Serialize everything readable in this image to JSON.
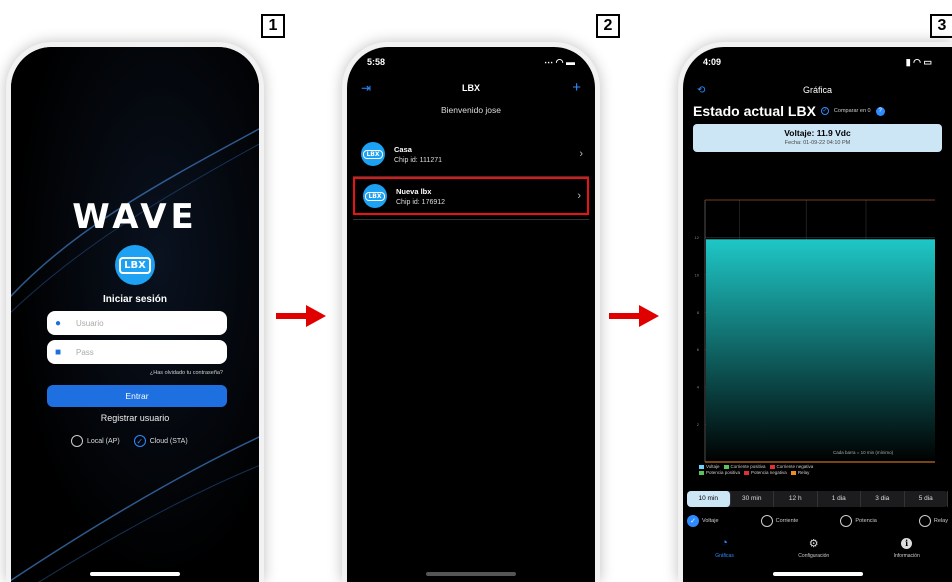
{
  "steps": [
    "1",
    "2",
    "3"
  ],
  "screen1": {
    "logo": "WAVE",
    "device_icon": "LBX",
    "title": "Iniciar sesión",
    "user_placeholder": "Usuario",
    "pass_placeholder": "Pass",
    "forgot": "¿Has olvidado tu contraseña?",
    "login_button": "Entrar",
    "register": "Registrar usuario",
    "mode_local": "Local (AP)",
    "mode_cloud": "Cloud (STA)",
    "mode_selected": "cloud"
  },
  "screen2": {
    "time": "5:58",
    "title": "LBX",
    "welcome": "Bienvenido jose",
    "devices": [
      {
        "name": "Casa",
        "chip": "Chip id: 111271",
        "selected": false
      },
      {
        "name": "Nueva lbx",
        "chip": "Chip id: 176912",
        "selected": true
      }
    ]
  },
  "screen3": {
    "time": "4:09",
    "nav_title": "Gráfica",
    "heading": "Estado actual LBX",
    "compare": "Comparar en 0",
    "voltage": "Voltaje: 11.9 Vdc",
    "date": "Fecha: 01-09-22 04:10 PM",
    "interval_note": "Cada barra = 10 min (mínimo)",
    "legend": [
      {
        "label": "Voltaje",
        "color": "#6ad2ff"
      },
      {
        "label": "Corriente positiva",
        "color": "#5ac45a"
      },
      {
        "label": "Corriente negativa",
        "color": "#e03030"
      },
      {
        "label": "Potencia positiva",
        "color": "#5ac45a"
      },
      {
        "label": "Potencia negativa",
        "color": "#e03030"
      },
      {
        "label": "Relay",
        "color": "#f08a24"
      }
    ],
    "ranges": [
      "10 min",
      "30 min",
      "12 h",
      "1 dia",
      "3 dia",
      "5 dia"
    ],
    "range_selected": "10 min",
    "series_options": [
      "Voltaje",
      "Corriente",
      "Potencia",
      "Relay"
    ],
    "series_selected": "Voltaje",
    "tabbar": [
      "Gráficas",
      "Configuración",
      "Información"
    ],
    "tab_selected": "Gráficas",
    "accent": "#2d8cff",
    "bar_color": "#1fc7c7"
  },
  "chart_data": {
    "type": "area",
    "series": [
      {
        "name": "Voltaje",
        "values": [
          11.9,
          11.9
        ]
      }
    ],
    "ylim": [
      0,
      14
    ],
    "yticks": [
      2,
      4,
      6,
      8,
      10,
      12
    ]
  }
}
